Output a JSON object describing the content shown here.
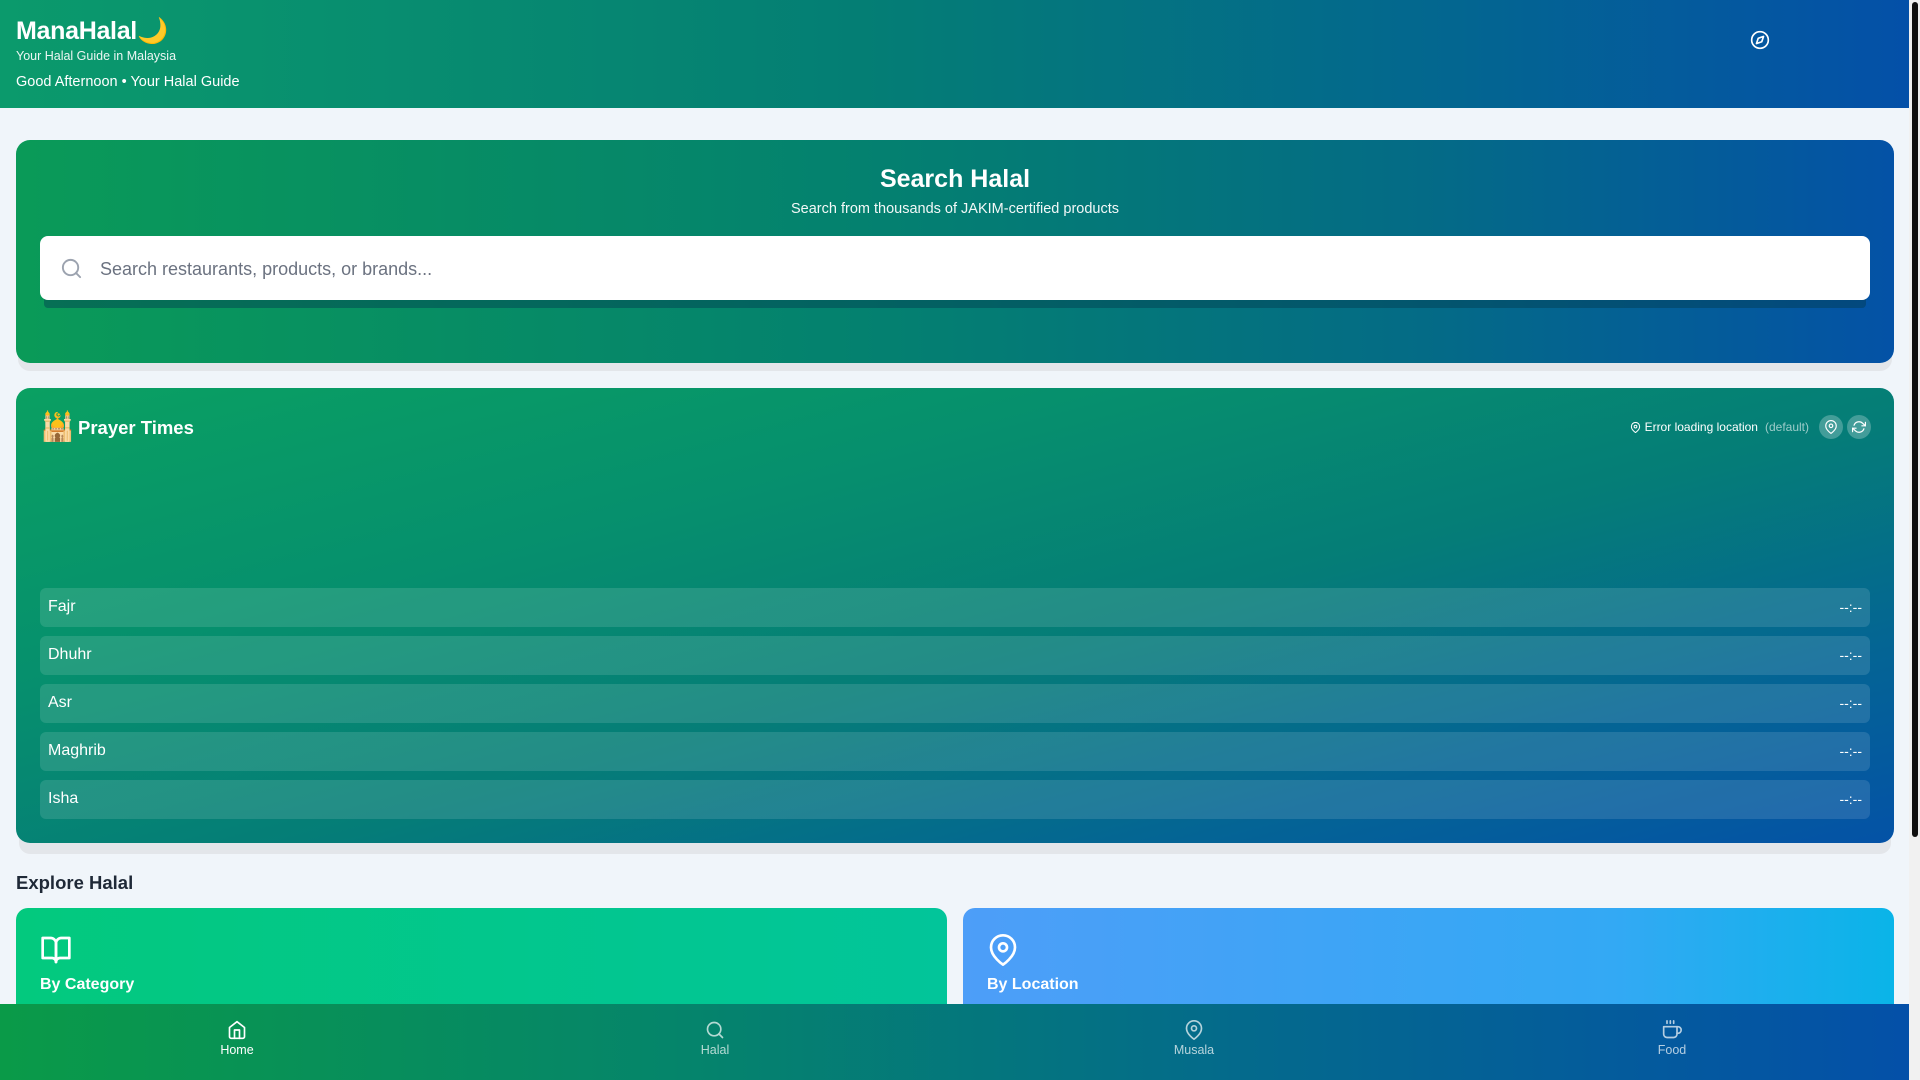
{
  "header": {
    "brand": "ManaHalal🌙",
    "tagline": "Your Halal Guide in Malaysia",
    "greeting": "Good Afternoon • Your Halal Guide",
    "compass_icon": "compass-icon"
  },
  "search": {
    "title": "Search Halal",
    "subtitle": "Search from thousands of JAKIM-certified products",
    "placeholder": "Search restaurants, products, or brands...",
    "value": ""
  },
  "prayer": {
    "icon": "🕌",
    "title": "Prayer Times",
    "location_status": "Error loading location",
    "location_default": "(default)",
    "rows": [
      {
        "name": "Fajr",
        "time": "--:--"
      },
      {
        "name": "Dhuhr",
        "time": "--:--"
      },
      {
        "name": "Asr",
        "time": "--:--"
      },
      {
        "name": "Maghrib",
        "time": "--:--"
      },
      {
        "name": "Isha",
        "time": "--:--"
      }
    ]
  },
  "explore": {
    "title": "Explore Halal",
    "tiles": [
      {
        "label": "By Category",
        "icon": "book-open-icon",
        "color": "#03c98a"
      },
      {
        "label": "By Location",
        "icon": "map-pin-icon",
        "color": "#3ea6f5"
      }
    ]
  },
  "nav": {
    "items": [
      {
        "label": "Home",
        "icon": "home-icon",
        "active": true
      },
      {
        "label": "Halal",
        "icon": "search-icon",
        "active": false
      },
      {
        "label": "Musala",
        "icon": "map-pin-icon",
        "active": false
      },
      {
        "label": "Food",
        "icon": "coffee-icon",
        "active": false
      }
    ]
  },
  "colors": {
    "brand_green": "#0a9a58",
    "brand_blue": "#0452a6",
    "page_bg": "#f0f5fa"
  }
}
